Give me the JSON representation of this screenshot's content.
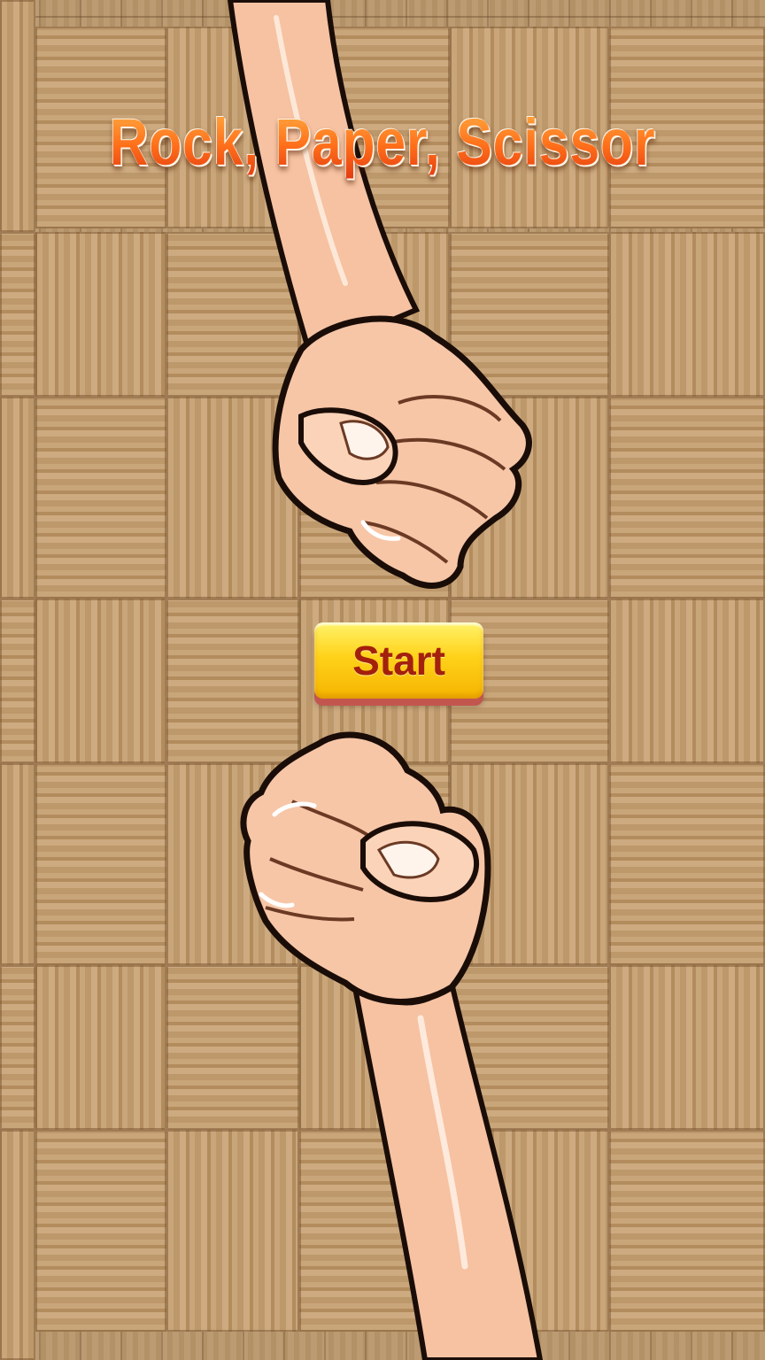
{
  "title": "Rock, Paper, Scissor",
  "start_button": {
    "label": "Start"
  },
  "players": {
    "top": {
      "gesture": "rock",
      "icon": "fist-icon"
    },
    "bottom": {
      "gesture": "rock",
      "icon": "fist-icon"
    }
  },
  "colors": {
    "title_orange": "#ff6f1a",
    "button_yellow": "#ffd21a",
    "button_text": "#a3200d",
    "floor_wood": "#b8966a",
    "skin": "#f6c2a2"
  }
}
